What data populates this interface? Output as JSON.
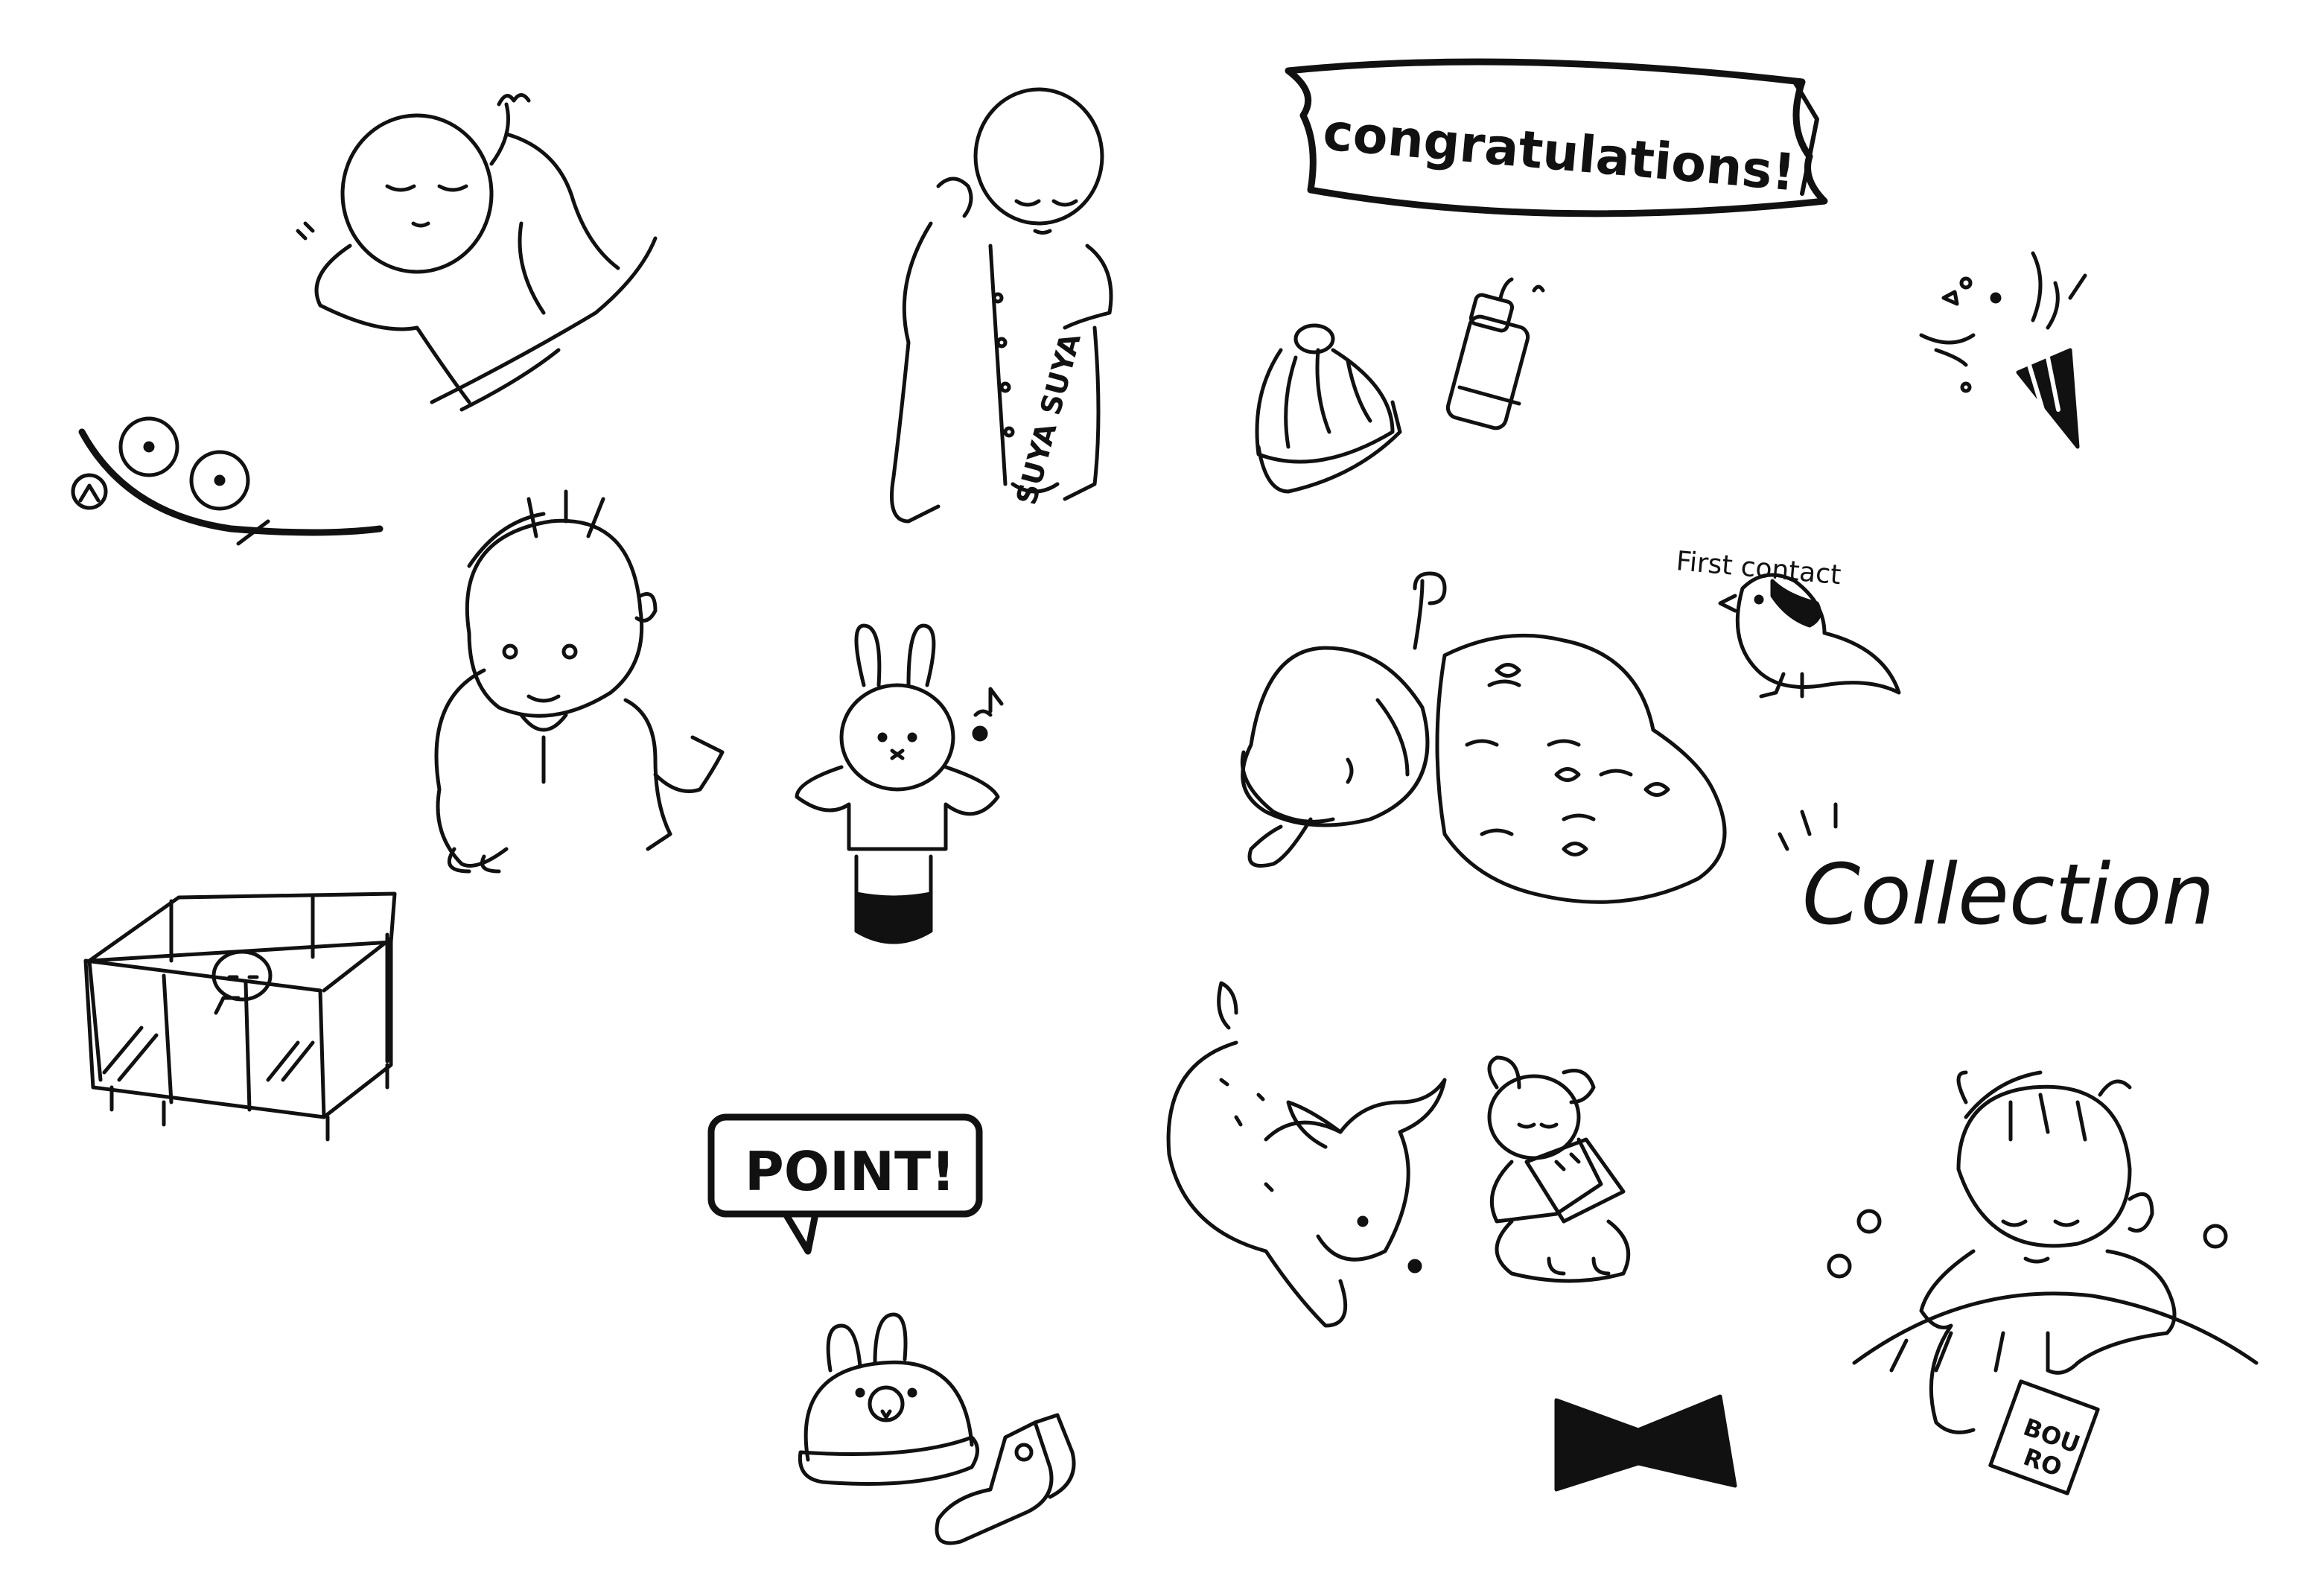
{
  "labels": {
    "congrats": "congratulations!",
    "suya": "SUYA SUYA",
    "first_contact": "First contact",
    "collection": "Collection",
    "point": "POINT!",
    "bouro_1": "BOU",
    "bouro_2": "RO"
  },
  "colors": {
    "ink": "#111111",
    "paper": "#ffffff"
  }
}
